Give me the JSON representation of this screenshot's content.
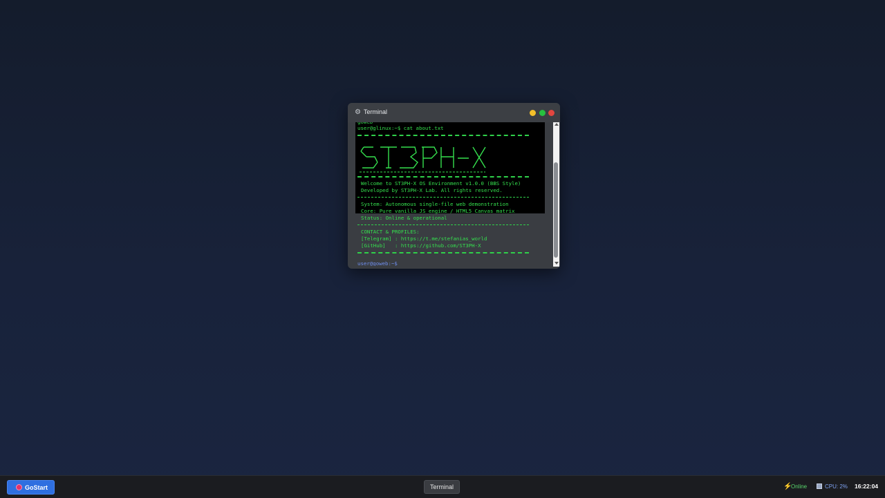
{
  "window": {
    "title": "Terminal",
    "icon": "gear-icon"
  },
  "terminal": {
    "partial_top": "goweb",
    "prompt": "user@glinux:~$ cat about.txt",
    "welcome": "Welcome to ST3PH-X OS Environment v1.0.0 (BBS Style)",
    "developed": "Developed by ST3PH-X Lab. All rights reserved.",
    "system": "System: Autonomous single-file web demonstration",
    "core": "Core: Pure vanilla JS engine / HTML5 Canvas matrix",
    "status": "Status: Online & operational",
    "contact_header": "CONTACT & PROFILES:",
    "telegram": "[Telegram] : https://t.me/stefanias_world",
    "github": "[GitHub]   : https://github.com/ST3PH-X",
    "prompt_end": "user@goweb:~$",
    "ascii_art": "ST3PH-X"
  },
  "taskbar": {
    "start_label": "GoStart",
    "task_label": "Terminal",
    "online_label": "Online",
    "cpu_label": "CPU: 2%",
    "clock": "16:22:04"
  },
  "colors": {
    "terminal_green": "#35e04e",
    "prompt_blue": "#6f8ff0",
    "start_blue": "#2f6fe0"
  }
}
